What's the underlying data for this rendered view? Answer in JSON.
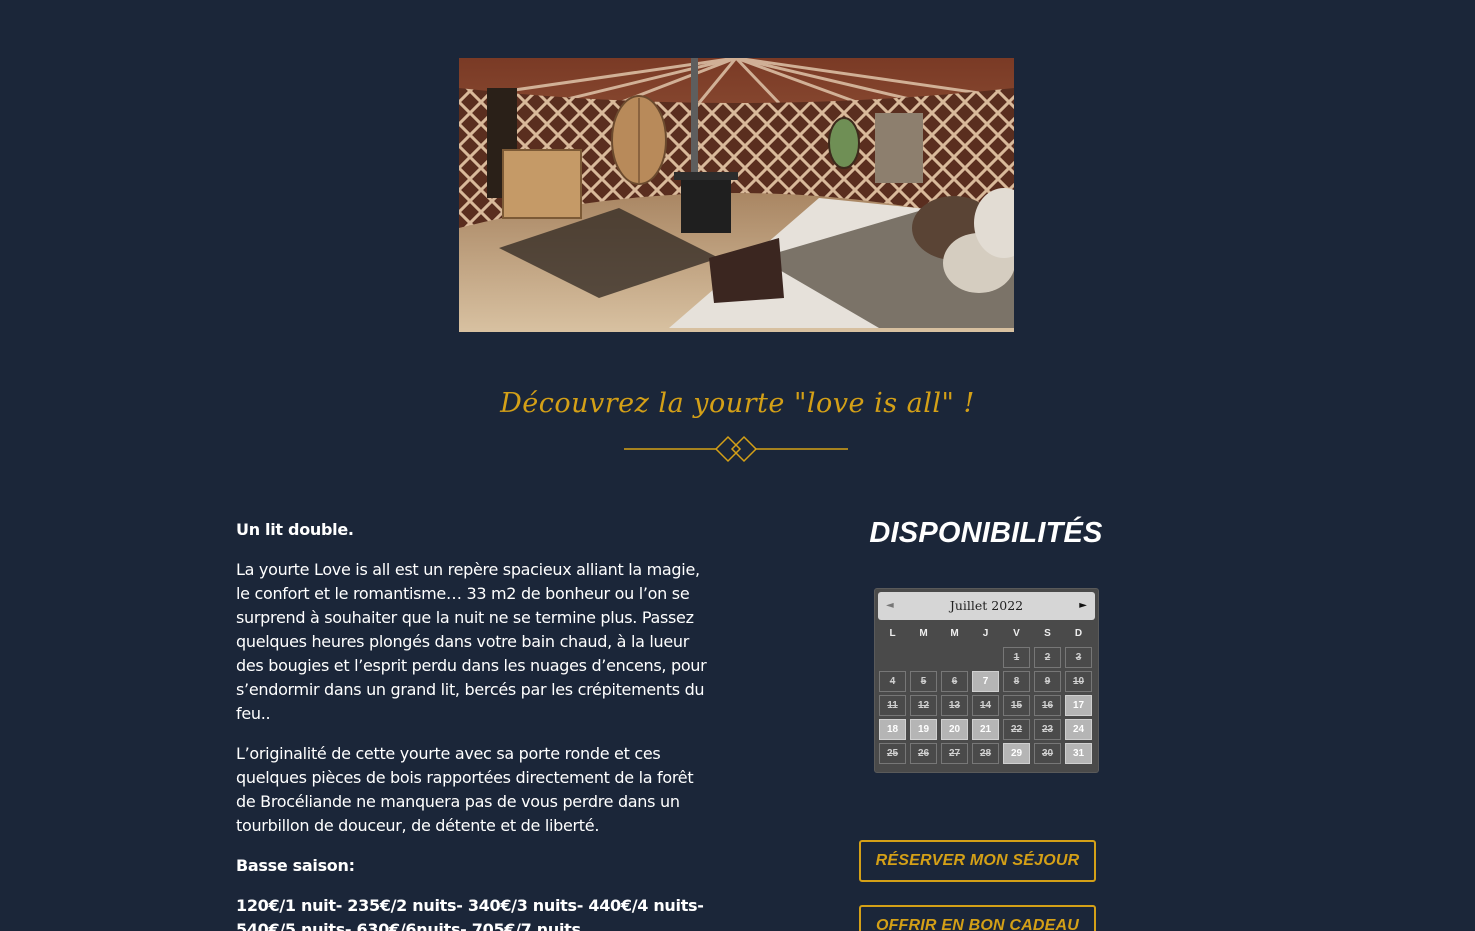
{
  "hero": {
    "image_alt": "Intérieur de la yourte"
  },
  "section": {
    "title": "Découvrez la yourte \"love is all\" !"
  },
  "content": {
    "p1": "Un lit double.",
    "p2": "La yourte Love is all est un repère spacieux alliant la magie, le confort et le romantisme… 33 m2 de bonheur ou l’on se surprend à souhaiter que la nuit ne se termine plus.  Passez quelques heures plongés dans votre bain chaud, à la lueur des bougies et l’esprit perdu dans les nuages d’encens, pour s’endormir dans un grand lit, bercés par les crépitements du feu..",
    "p3": "L’originalité de cette yourte avec sa porte ronde et ces quelques pièces de bois rapportées directement de la forêt de Brocéliande ne manquera pas de vous perdre dans un tourbillon de douceur, de détente et de liberté.",
    "p4": "Basse saison:",
    "p5": "120€/1 nuit- 235€/2 nuits- 340€/3 nuits- 440€/4 nuits- 540€/5 nuits- 630€/6nuits- 705€/7 nuits"
  },
  "availability": {
    "title": "DISPONIBILITÉS",
    "calendar": {
      "month_label": "Juillet 2022",
      "prev_icon": "◄",
      "next_icon": "►",
      "weekdays": [
        "L",
        "M",
        "M",
        "J",
        "V",
        "S",
        "D"
      ],
      "leading_blanks": 4,
      "days": [
        {
          "n": "1",
          "free": false
        },
        {
          "n": "2",
          "free": false
        },
        {
          "n": "3",
          "free": false
        },
        {
          "n": "4",
          "free": false
        },
        {
          "n": "5",
          "free": false
        },
        {
          "n": "6",
          "free": false
        },
        {
          "n": "7",
          "free": true
        },
        {
          "n": "8",
          "free": false
        },
        {
          "n": "9",
          "free": false
        },
        {
          "n": "10",
          "free": false
        },
        {
          "n": "11",
          "free": false
        },
        {
          "n": "12",
          "free": false
        },
        {
          "n": "13",
          "free": false
        },
        {
          "n": "14",
          "free": false
        },
        {
          "n": "15",
          "free": false
        },
        {
          "n": "16",
          "free": false
        },
        {
          "n": "17",
          "free": true
        },
        {
          "n": "18",
          "free": true
        },
        {
          "n": "19",
          "free": true
        },
        {
          "n": "20",
          "free": true
        },
        {
          "n": "21",
          "free": true
        },
        {
          "n": "22",
          "free": false
        },
        {
          "n": "23",
          "free": false
        },
        {
          "n": "24",
          "free": true
        },
        {
          "n": "25",
          "free": false
        },
        {
          "n": "26",
          "free": false
        },
        {
          "n": "27",
          "free": false
        },
        {
          "n": "28",
          "free": false
        },
        {
          "n": "29",
          "free": true
        },
        {
          "n": "30",
          "free": false
        },
        {
          "n": "31",
          "free": true
        }
      ]
    }
  },
  "buttons": {
    "reserve": "RÉSERVER MON SÉJOUR",
    "gift": "OFFRIR EN BON CADEAU"
  },
  "colors": {
    "background": "#1b2639",
    "accent": "#d4a017",
    "text": "#ffffff"
  }
}
